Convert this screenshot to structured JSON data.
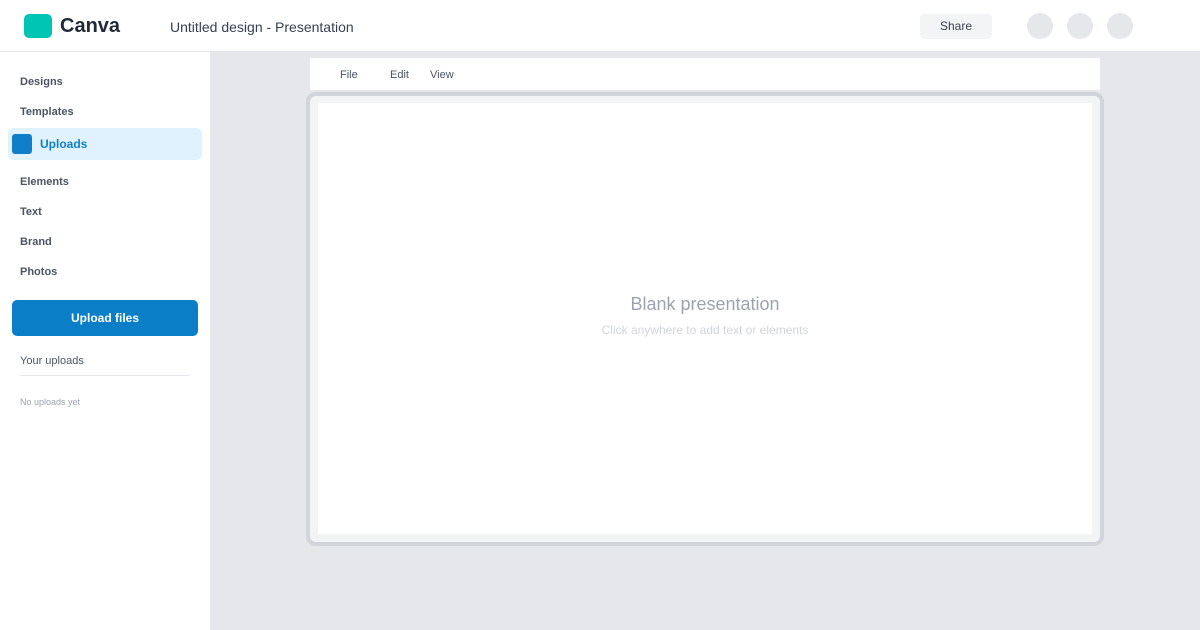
{
  "app": {
    "logo_text": "Canva",
    "brand_color": "#00c4b4",
    "accent_color": "#0a7fc7"
  },
  "header": {
    "document_title": "Untitled design - Presentation",
    "share_label": "Share",
    "icons": [
      "user-avatar-icon",
      "settings-icon",
      "profile-icon"
    ]
  },
  "sidebar": {
    "items": [
      {
        "label": "Designs"
      },
      {
        "label": "Templates"
      },
      {
        "label": "Uploads",
        "active": true
      },
      {
        "label": "Elements"
      },
      {
        "label": "Text"
      },
      {
        "label": "Brand"
      },
      {
        "label": "Photos"
      }
    ],
    "upload_button": "Upload files",
    "uploads_heading": "Your uploads",
    "empty_message": "No uploads yet"
  },
  "editor": {
    "menu": [
      "File",
      "Edit",
      "View"
    ],
    "canvas_title": "Blank presentation",
    "canvas_hint": "Click anywhere to add text or elements"
  }
}
